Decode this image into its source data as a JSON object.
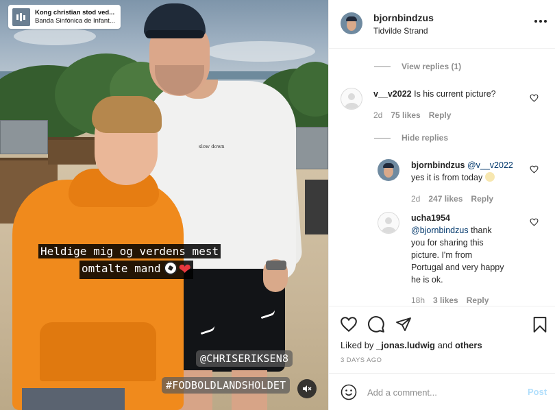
{
  "music": {
    "title": "Kong christian stod ved...",
    "artist": "Banda Sinfónica de Infant..."
  },
  "media": {
    "caption_line1": "Heldige mig og verdens mest",
    "caption_line2": "omtalte mand",
    "shirt_text": "slow down",
    "tag_mention": "@CHRISERIKSEN8",
    "tag_hashtag": "#FODBOLDLANDSHOLDET",
    "mute_icon": "speaker-muted-icon"
  },
  "header": {
    "username": "bjornbindzus",
    "location": "Tidvilde Strand"
  },
  "comments": {
    "view_replies": "View replies (1)",
    "hide_replies": "Hide replies",
    "items": [
      {
        "username": "v__v2022",
        "text": "Is his current picture?",
        "time": "2d",
        "likes": "75 likes",
        "reply": "Reply"
      },
      {
        "username": "bjornbindzus",
        "mention": "@v__v2022",
        "text": "yes it is from today",
        "time": "2d",
        "likes": "247 likes",
        "reply": "Reply"
      },
      {
        "username": "ucha1954",
        "mention": "@bjornbindzus",
        "text_line1": "thank",
        "text_line2": "you for sharing this",
        "text_line3": "picture. I'm from",
        "text_line4": "Portugal and very happy",
        "text_line5": "he is ok.",
        "time": "18h",
        "likes": "3 likes",
        "reply": "Reply"
      }
    ]
  },
  "actions": {
    "liked_prefix": "Liked by",
    "liked_user": "_jonas.ludwig",
    "liked_and": "and",
    "liked_others": "others",
    "timestamp": "3 DAYS AGO"
  },
  "add_comment": {
    "placeholder": "Add a comment...",
    "post_label": "Post"
  },
  "colors": {
    "link": "#00376b",
    "secondary_text": "#8e8e8e",
    "post_disabled": "#b2dffc",
    "hoodie": "#f08a1c"
  }
}
